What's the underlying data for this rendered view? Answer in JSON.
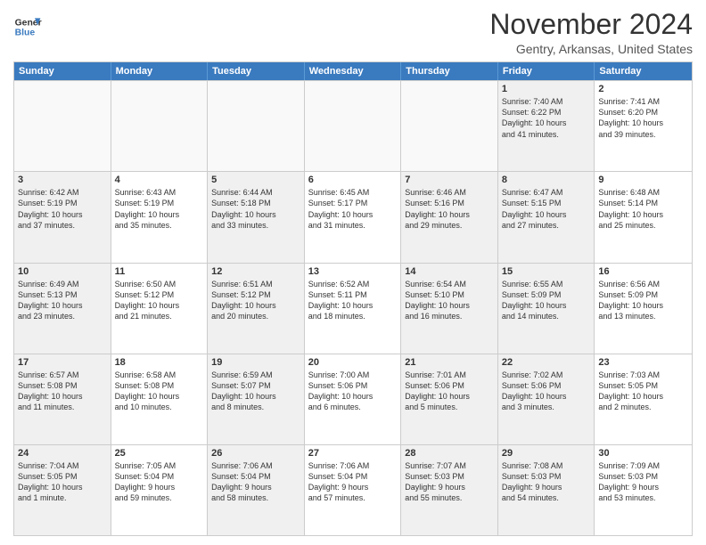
{
  "header": {
    "logo_line1": "General",
    "logo_line2": "Blue",
    "month": "November 2024",
    "location": "Gentry, Arkansas, United States"
  },
  "weekdays": [
    "Sunday",
    "Monday",
    "Tuesday",
    "Wednesday",
    "Thursday",
    "Friday",
    "Saturday"
  ],
  "rows": [
    [
      {
        "day": "",
        "info": "",
        "empty": true
      },
      {
        "day": "",
        "info": "",
        "empty": true
      },
      {
        "day": "",
        "info": "",
        "empty": true
      },
      {
        "day": "",
        "info": "",
        "empty": true
      },
      {
        "day": "",
        "info": "",
        "empty": true
      },
      {
        "day": "1",
        "info": "Sunrise: 7:40 AM\nSunset: 6:22 PM\nDaylight: 10 hours\nand 41 minutes.",
        "shaded": true
      },
      {
        "day": "2",
        "info": "Sunrise: 7:41 AM\nSunset: 6:20 PM\nDaylight: 10 hours\nand 39 minutes."
      }
    ],
    [
      {
        "day": "3",
        "info": "Sunrise: 6:42 AM\nSunset: 5:19 PM\nDaylight: 10 hours\nand 37 minutes.",
        "shaded": true
      },
      {
        "day": "4",
        "info": "Sunrise: 6:43 AM\nSunset: 5:19 PM\nDaylight: 10 hours\nand 35 minutes."
      },
      {
        "day": "5",
        "info": "Sunrise: 6:44 AM\nSunset: 5:18 PM\nDaylight: 10 hours\nand 33 minutes.",
        "shaded": true
      },
      {
        "day": "6",
        "info": "Sunrise: 6:45 AM\nSunset: 5:17 PM\nDaylight: 10 hours\nand 31 minutes."
      },
      {
        "day": "7",
        "info": "Sunrise: 6:46 AM\nSunset: 5:16 PM\nDaylight: 10 hours\nand 29 minutes.",
        "shaded": true
      },
      {
        "day": "8",
        "info": "Sunrise: 6:47 AM\nSunset: 5:15 PM\nDaylight: 10 hours\nand 27 minutes.",
        "shaded": true
      },
      {
        "day": "9",
        "info": "Sunrise: 6:48 AM\nSunset: 5:14 PM\nDaylight: 10 hours\nand 25 minutes."
      }
    ],
    [
      {
        "day": "10",
        "info": "Sunrise: 6:49 AM\nSunset: 5:13 PM\nDaylight: 10 hours\nand 23 minutes.",
        "shaded": true
      },
      {
        "day": "11",
        "info": "Sunrise: 6:50 AM\nSunset: 5:12 PM\nDaylight: 10 hours\nand 21 minutes."
      },
      {
        "day": "12",
        "info": "Sunrise: 6:51 AM\nSunset: 5:12 PM\nDaylight: 10 hours\nand 20 minutes.",
        "shaded": true
      },
      {
        "day": "13",
        "info": "Sunrise: 6:52 AM\nSunset: 5:11 PM\nDaylight: 10 hours\nand 18 minutes."
      },
      {
        "day": "14",
        "info": "Sunrise: 6:54 AM\nSunset: 5:10 PM\nDaylight: 10 hours\nand 16 minutes.",
        "shaded": true
      },
      {
        "day": "15",
        "info": "Sunrise: 6:55 AM\nSunset: 5:09 PM\nDaylight: 10 hours\nand 14 minutes.",
        "shaded": true
      },
      {
        "day": "16",
        "info": "Sunrise: 6:56 AM\nSunset: 5:09 PM\nDaylight: 10 hours\nand 13 minutes."
      }
    ],
    [
      {
        "day": "17",
        "info": "Sunrise: 6:57 AM\nSunset: 5:08 PM\nDaylight: 10 hours\nand 11 minutes.",
        "shaded": true
      },
      {
        "day": "18",
        "info": "Sunrise: 6:58 AM\nSunset: 5:08 PM\nDaylight: 10 hours\nand 10 minutes."
      },
      {
        "day": "19",
        "info": "Sunrise: 6:59 AM\nSunset: 5:07 PM\nDaylight: 10 hours\nand 8 minutes.",
        "shaded": true
      },
      {
        "day": "20",
        "info": "Sunrise: 7:00 AM\nSunset: 5:06 PM\nDaylight: 10 hours\nand 6 minutes."
      },
      {
        "day": "21",
        "info": "Sunrise: 7:01 AM\nSunset: 5:06 PM\nDaylight: 10 hours\nand 5 minutes.",
        "shaded": true
      },
      {
        "day": "22",
        "info": "Sunrise: 7:02 AM\nSunset: 5:06 PM\nDaylight: 10 hours\nand 3 minutes.",
        "shaded": true
      },
      {
        "day": "23",
        "info": "Sunrise: 7:03 AM\nSunset: 5:05 PM\nDaylight: 10 hours\nand 2 minutes."
      }
    ],
    [
      {
        "day": "24",
        "info": "Sunrise: 7:04 AM\nSunset: 5:05 PM\nDaylight: 10 hours\nand 1 minute.",
        "shaded": true
      },
      {
        "day": "25",
        "info": "Sunrise: 7:05 AM\nSunset: 5:04 PM\nDaylight: 9 hours\nand 59 minutes."
      },
      {
        "day": "26",
        "info": "Sunrise: 7:06 AM\nSunset: 5:04 PM\nDaylight: 9 hours\nand 58 minutes.",
        "shaded": true
      },
      {
        "day": "27",
        "info": "Sunrise: 7:06 AM\nSunset: 5:04 PM\nDaylight: 9 hours\nand 57 minutes."
      },
      {
        "day": "28",
        "info": "Sunrise: 7:07 AM\nSunset: 5:03 PM\nDaylight: 9 hours\nand 55 minutes.",
        "shaded": true
      },
      {
        "day": "29",
        "info": "Sunrise: 7:08 AM\nSunset: 5:03 PM\nDaylight: 9 hours\nand 54 minutes.",
        "shaded": true
      },
      {
        "day": "30",
        "info": "Sunrise: 7:09 AM\nSunset: 5:03 PM\nDaylight: 9 hours\nand 53 minutes."
      }
    ]
  ]
}
